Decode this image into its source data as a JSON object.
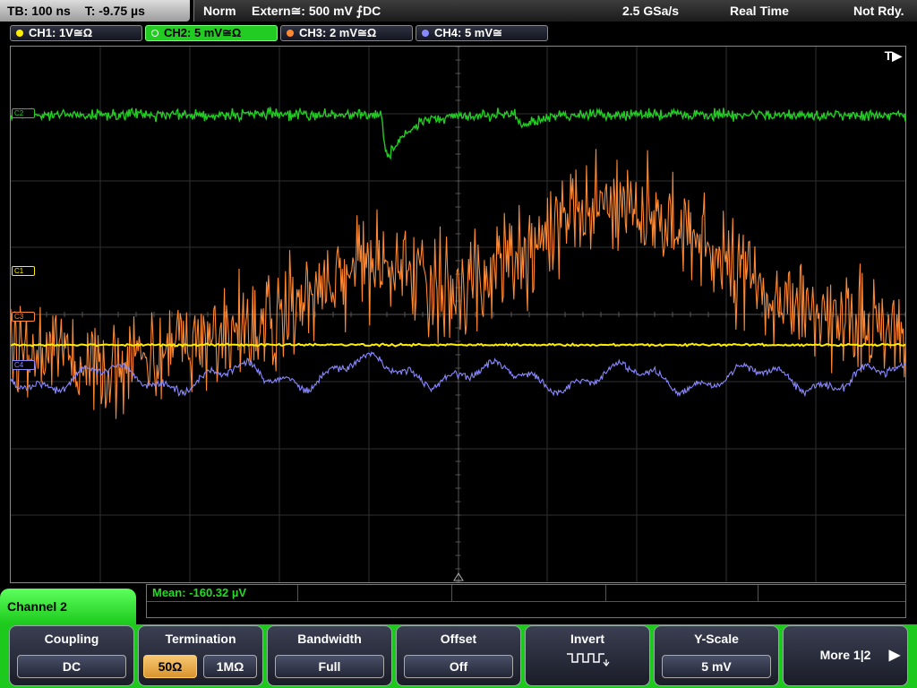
{
  "topbar": {
    "timebase": "TB: 100 ns",
    "trigger_time": "T: -9.75 µs",
    "mode": "Norm",
    "trigger_source": "Extern≅: 500 mV ⨍DC",
    "sample_rate": "2.5 GSa/s",
    "acq_mode": "Real Time",
    "status": "Not Rdy."
  },
  "channels": [
    {
      "label": "CH1: 1V≅Ω",
      "color": "#ffee00"
    },
    {
      "label": "CH2: 5 mV≅Ω",
      "color": "#22cc22",
      "active": true
    },
    {
      "label": "CH3: 2 mV≅Ω",
      "color": "#ff8833"
    },
    {
      "label": "CH4: 5 mV≅",
      "color": "#8888ff"
    }
  ],
  "grid": {
    "trigger_indicator": "T▶",
    "markers": {
      "c1": "C1",
      "c2": "C2",
      "c3": "C3",
      "c4": "C4"
    }
  },
  "measurement": {
    "text": "Mean: -160.32 µV"
  },
  "menu": {
    "title": "Channel 2"
  },
  "softkeys": {
    "coupling": {
      "label": "Coupling",
      "value": "DC"
    },
    "termination": {
      "label": "Termination",
      "options": [
        "50Ω",
        "1MΩ"
      ],
      "selected": "50Ω"
    },
    "bandwidth": {
      "label": "Bandwidth",
      "value": "Full"
    },
    "offset": {
      "label": "Offset",
      "value": "Off"
    },
    "invert": {
      "label": "Invert",
      "icon": "invert-pulse-icon"
    },
    "yscale": {
      "label": "Y-Scale",
      "value": "5 mV"
    },
    "more": {
      "label": "More 1|2",
      "icon": "arrow-right-icon"
    }
  },
  "colors": {
    "ch1": "#ffee00",
    "ch2": "#22cc22",
    "ch3": "#ff8833",
    "ch4": "#8888ff",
    "menu_accent": "#1dc91d",
    "selected_option": "#f0b050"
  }
}
